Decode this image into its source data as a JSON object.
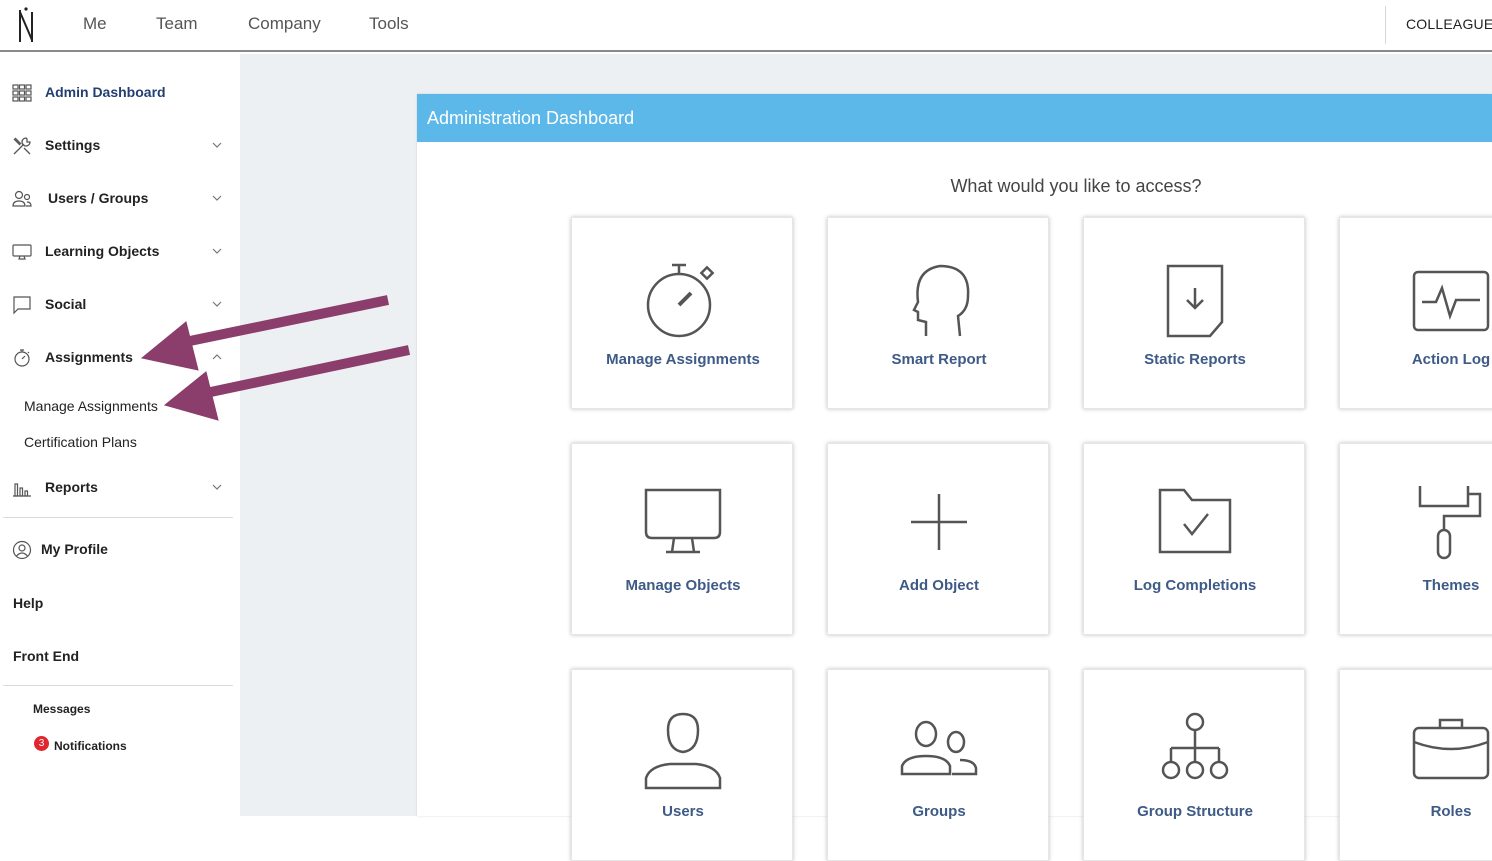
{
  "topbar": {
    "nav": [
      "Me",
      "Team",
      "Company",
      "Tools"
    ],
    "right_link": "COLLEAGUES"
  },
  "sidebar": {
    "items": [
      {
        "label": "Admin Dashboard",
        "icon": "grid-icon",
        "active": true
      },
      {
        "label": "Settings",
        "icon": "tools-icon"
      },
      {
        "label": "Users / Groups",
        "icon": "users-icon"
      },
      {
        "label": "Learning Objects",
        "icon": "monitor-icon"
      },
      {
        "label": "Social",
        "icon": "chat-icon"
      },
      {
        "label": "Assignments",
        "icon": "stopwatch-icon",
        "expanded": true
      },
      {
        "label": "Reports",
        "icon": "bar-chart-icon"
      }
    ],
    "sub_items": [
      "Manage Assignments",
      "Certification Plans"
    ],
    "links": [
      "My Profile",
      "Help",
      "Front End"
    ],
    "footer": {
      "messages": "Messages",
      "notifications": "Notifications",
      "notification_count": "3"
    }
  },
  "panel": {
    "title": "Administration Dashboard",
    "prompt": "What would you like to access?",
    "tiles": [
      {
        "label": "Manage Assignments",
        "icon": "stopwatch-icon"
      },
      {
        "label": "Smart Report",
        "icon": "head-icon"
      },
      {
        "label": "Static Reports",
        "icon": "document-download-icon"
      },
      {
        "label": "Action Log",
        "icon": "activity-monitor-icon"
      },
      {
        "label": "Manage Objects",
        "icon": "monitor-icon"
      },
      {
        "label": "Add Object",
        "icon": "plus-icon"
      },
      {
        "label": "Log Completions",
        "icon": "folder-check-icon"
      },
      {
        "label": "Themes",
        "icon": "paint-roller-icon"
      },
      {
        "label": "Users",
        "icon": "user-icon"
      },
      {
        "label": "Groups",
        "icon": "group-icon"
      },
      {
        "label": "Group Structure",
        "icon": "hierarchy-icon"
      },
      {
        "label": "Roles",
        "icon": "briefcase-icon"
      }
    ]
  },
  "colors": {
    "header_blue": "#5bb8e8",
    "tile_label": "#3e5a86",
    "active_nav": "#233f72",
    "annotation_arrow": "#8b3d6b",
    "badge_red": "#e0262f"
  }
}
